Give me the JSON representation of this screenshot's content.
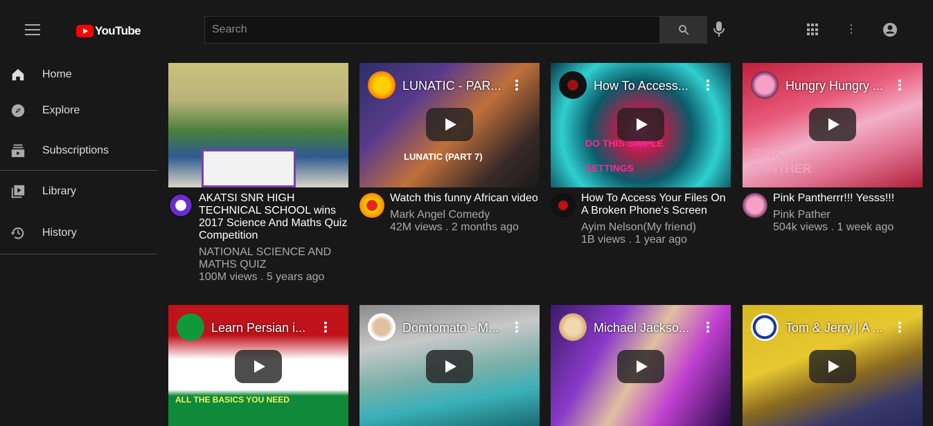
{
  "header": {
    "logo_text": "YouTube",
    "search_placeholder": "Search"
  },
  "sidebar": {
    "items": [
      {
        "label": "Home",
        "icon": "home-icon"
      },
      {
        "label": "Explore",
        "icon": "compass-icon"
      },
      {
        "label": "Subscriptions",
        "icon": "subscriptions-icon"
      },
      {
        "label": "Library",
        "icon": "library-icon"
      },
      {
        "label": "History",
        "icon": "history-icon"
      }
    ]
  },
  "videos": [
    {
      "title": "AKATSI SNR HIGH TECHNICAL SCHOOL wins 2017 Science And Maths Quiz Competition",
      "channel": "NATIONAL SCIENCE AND MATHS QUIZ",
      "stats": "100M views . 5 years ago"
    },
    {
      "thumb_title": "LUNATIC - PAR...",
      "thumb_text": "LUNATIC (PART 7)",
      "title": "Watch this funny African video",
      "channel": "Mark Angel Comedy",
      "stats": "42M views . 2 months ago"
    },
    {
      "thumb_title": "How To Access...",
      "thumb_text": "DO THIS SIMPLE SETTINGS",
      "title": "How To Access Your Files On A Broken Phone's Screen",
      "channel": "Ayim Nelson(My friend)",
      "stats": "1B views . 1 year ago"
    },
    {
      "thumb_title": "Hungry Hungry ...",
      "thumb_text": "PINK PANTHER",
      "title": "Pink Pantherrr!!! Yesss!!!",
      "channel": "Pink Pather",
      "stats": "504k views . 1 week ago"
    },
    {
      "thumb_title": "Learn Persian i...",
      "thumb_text": "ALL THE BASICS YOU NEED"
    },
    {
      "thumb_title": "Domtomato - M..."
    },
    {
      "thumb_title": "Michael Jackso..."
    },
    {
      "thumb_title": "Tom & Jerry | A ..."
    }
  ]
}
